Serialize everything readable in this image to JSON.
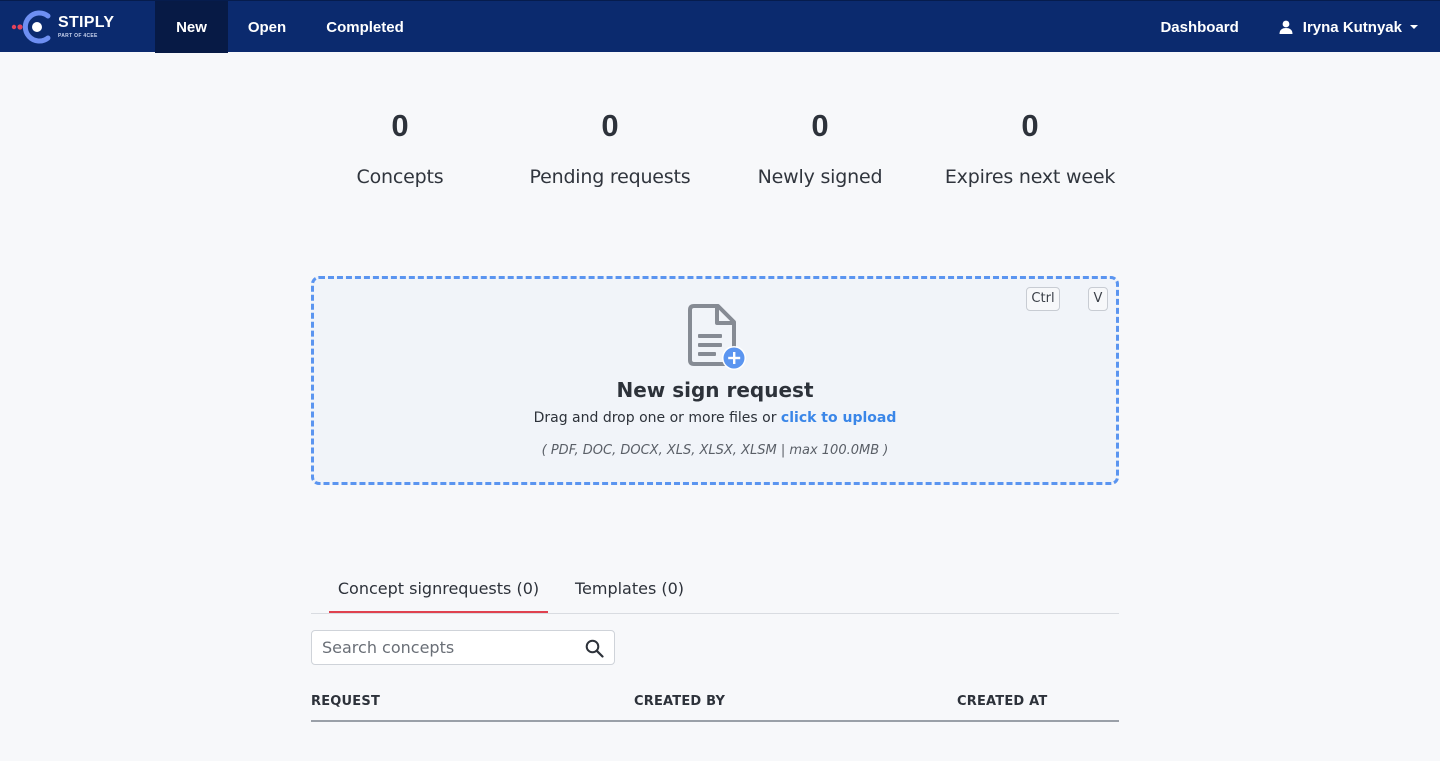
{
  "brand": {
    "name": "STIPLY",
    "tagline": "PART OF 4CEE",
    "colors": {
      "nav": "#0b2a6e",
      "accent": "#5b95f0",
      "link": "#3a86e8",
      "tab_active": "#e0414f"
    }
  },
  "nav": {
    "items": [
      {
        "label": "New",
        "active": true
      },
      {
        "label": "Open"
      },
      {
        "label": "Completed"
      }
    ],
    "dashboard_label": "Dashboard",
    "user_name": "Iryna Kutnyak",
    "user_icon": "user-icon"
  },
  "stats": [
    {
      "value": "0",
      "label": "Concepts"
    },
    {
      "value": "0",
      "label": "Pending requests"
    },
    {
      "value": "0",
      "label": "Newly signed"
    },
    {
      "value": "0",
      "label": "Expires next week"
    }
  ],
  "dropzone": {
    "shortcut_keys": [
      "Ctrl",
      "V"
    ],
    "icon": "document-add-icon",
    "title": "New sign request",
    "subtitle_prefix": "Drag and drop one or more files or ",
    "upload_link": "click to upload",
    "file_types": "( PDF, DOC, DOCX, XLS, XLSX, XLSM | max 100.0MB )"
  },
  "tabs": [
    {
      "label": "Concept signrequests (0)",
      "active": true
    },
    {
      "label": "Templates (0)"
    }
  ],
  "search": {
    "placeholder": "Search concepts",
    "value": ""
  },
  "table": {
    "columns": [
      "REQUEST",
      "CREATED BY",
      "CREATED AT"
    ],
    "rows": []
  }
}
